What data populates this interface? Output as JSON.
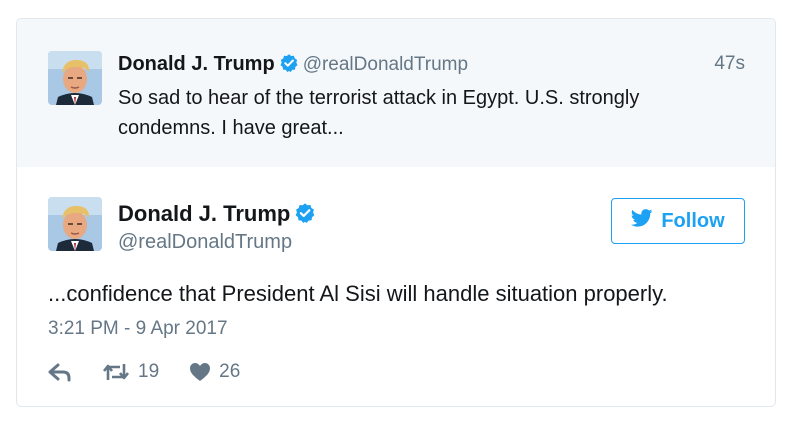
{
  "parent_tweet": {
    "name": "Donald J. Trump",
    "handle": "@realDonaldTrump",
    "time": "47s",
    "text": "So sad to hear of the terrorist attack in Egypt. U.S. strongly condemns. I have great..."
  },
  "main_tweet": {
    "name": "Donald J. Trump",
    "handle": "@realDonaldTrump",
    "follow_label": "Follow",
    "text": "...confidence that President Al Sisi will handle situation properly.",
    "timestamp": "3:21 PM - 9 Apr 2017",
    "retweet_count": "19",
    "like_count": "26"
  },
  "icons": {
    "verified": "verified-badge-icon",
    "reply": "reply-icon",
    "retweet": "retweet-icon",
    "like": "heart-icon",
    "twitter_bird": "twitter-bird-icon"
  },
  "colors": {
    "accent": "#1da1f2",
    "verified": "#1da1f2",
    "secondary_text": "#657786",
    "parent_background": "#f5f8fa"
  }
}
